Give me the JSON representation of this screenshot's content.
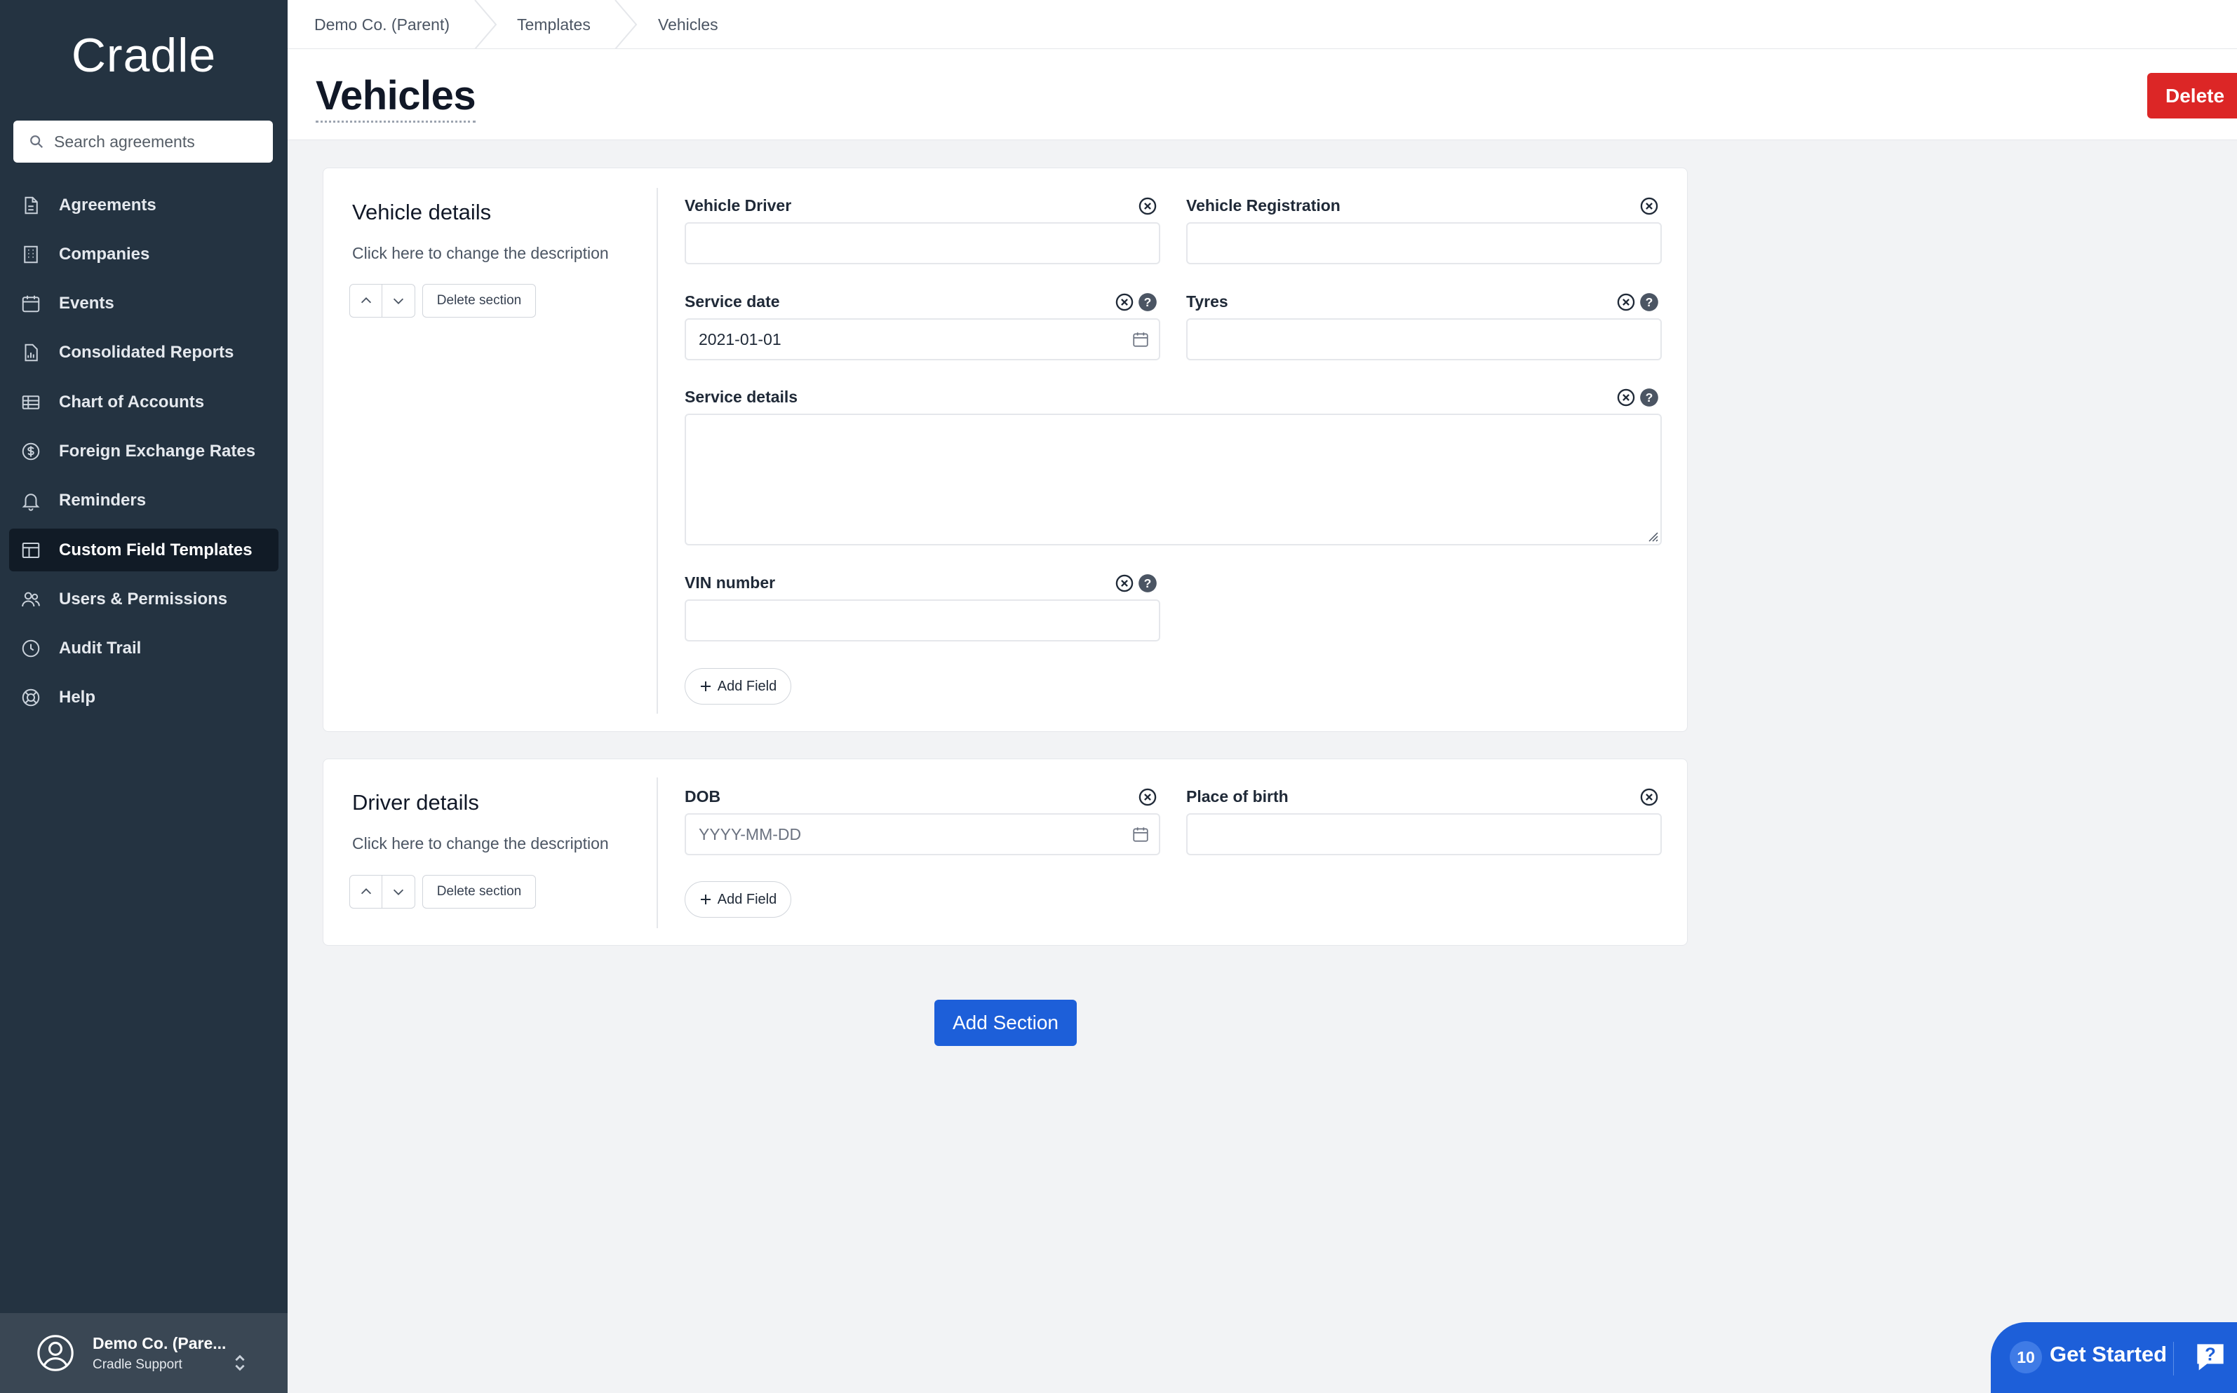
{
  "sidebar": {
    "logo": "Cradle",
    "search": {
      "placeholder": "Search agreements"
    },
    "items": [
      {
        "label": "Agreements",
        "icon": "document-icon"
      },
      {
        "label": "Companies",
        "icon": "building-icon"
      },
      {
        "label": "Events",
        "icon": "calendar-icon"
      },
      {
        "label": "Consolidated Reports",
        "icon": "report-icon"
      },
      {
        "label": "Chart of Accounts",
        "icon": "table-icon"
      },
      {
        "label": "Foreign Exchange Rates",
        "icon": "dollar-icon"
      },
      {
        "label": "Reminders",
        "icon": "bell-icon"
      },
      {
        "label": "Custom Field Templates",
        "icon": "template-icon",
        "active": true
      },
      {
        "label": "Users & Permissions",
        "icon": "users-icon"
      },
      {
        "label": "Audit Trail",
        "icon": "clock-icon"
      },
      {
        "label": "Help",
        "icon": "lifebuoy-icon"
      }
    ],
    "account": {
      "name": "Demo Co. (Pare...",
      "sub": "Cradle Support"
    }
  },
  "breadcrumb": [
    "Demo Co. (Parent)",
    "Templates",
    "Vehicles"
  ],
  "header": {
    "title": "Vehicles",
    "delete_label": "Delete"
  },
  "sections": [
    {
      "title": "Vehicle details",
      "description": "Click here to change the description",
      "delete_label": "Delete section",
      "add_field_label": "Add Field",
      "fields": {
        "vehicle_driver": {
          "label": "Vehicle Driver",
          "value": ""
        },
        "vehicle_registration": {
          "label": "Vehicle Registration",
          "value": ""
        },
        "service_date": {
          "label": "Service date",
          "value": "2021-01-01"
        },
        "tyres": {
          "label": "Tyres",
          "value": ""
        },
        "service_details": {
          "label": "Service details",
          "value": ""
        },
        "vin_number": {
          "label": "VIN number",
          "value": ""
        }
      }
    },
    {
      "title": "Driver details",
      "description": "Click here to change the description",
      "delete_label": "Delete section",
      "add_field_label": "Add Field",
      "fields": {
        "dob": {
          "label": "DOB",
          "placeholder": "YYYY-MM-DD"
        },
        "place_of_birth": {
          "label": "Place of birth",
          "value": ""
        }
      }
    }
  ],
  "add_section_label": "Add Section",
  "get_started": {
    "count": "10",
    "label": "Get Started"
  },
  "colors": {
    "sidebar": "#243341",
    "primary": "#1d5fd9",
    "danger": "#dc2626"
  }
}
